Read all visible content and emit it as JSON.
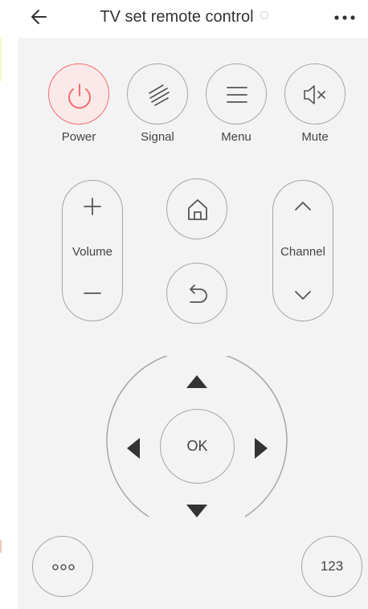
{
  "header": {
    "title": "TV set remote control",
    "back_icon": "back-arrow-icon",
    "more_icon": "more-dots-icon"
  },
  "top_row": [
    {
      "label": "Power",
      "icon": "power-icon",
      "color": "#f26d6d"
    },
    {
      "label": "Signal",
      "icon": "signal-icon"
    },
    {
      "label": "Menu",
      "icon": "menu-icon"
    },
    {
      "label": "Mute",
      "icon": "mute-icon"
    }
  ],
  "volume": {
    "label": "Volume",
    "up_icon": "plus-icon",
    "down_icon": "minus-icon"
  },
  "channel": {
    "label": "Channel",
    "up_icon": "chevron-up-icon",
    "down_icon": "chevron-down-icon"
  },
  "center": {
    "home_icon": "home-icon",
    "back_icon": "return-icon"
  },
  "dpad": {
    "ok_label": "OK",
    "up_icon": "arrow-up-icon",
    "down_icon": "arrow-down-icon",
    "left_icon": "arrow-left-icon",
    "right_icon": "arrow-right-icon"
  },
  "bottom": {
    "more_icon": "more-options-icon",
    "numpad_label": "123"
  },
  "colors": {
    "power_accent": "#f26d6d",
    "power_fill": "#fbe9e9",
    "panel_background": "#f3f3f3",
    "outline": "#a6a6a6",
    "icon": "#555555"
  }
}
